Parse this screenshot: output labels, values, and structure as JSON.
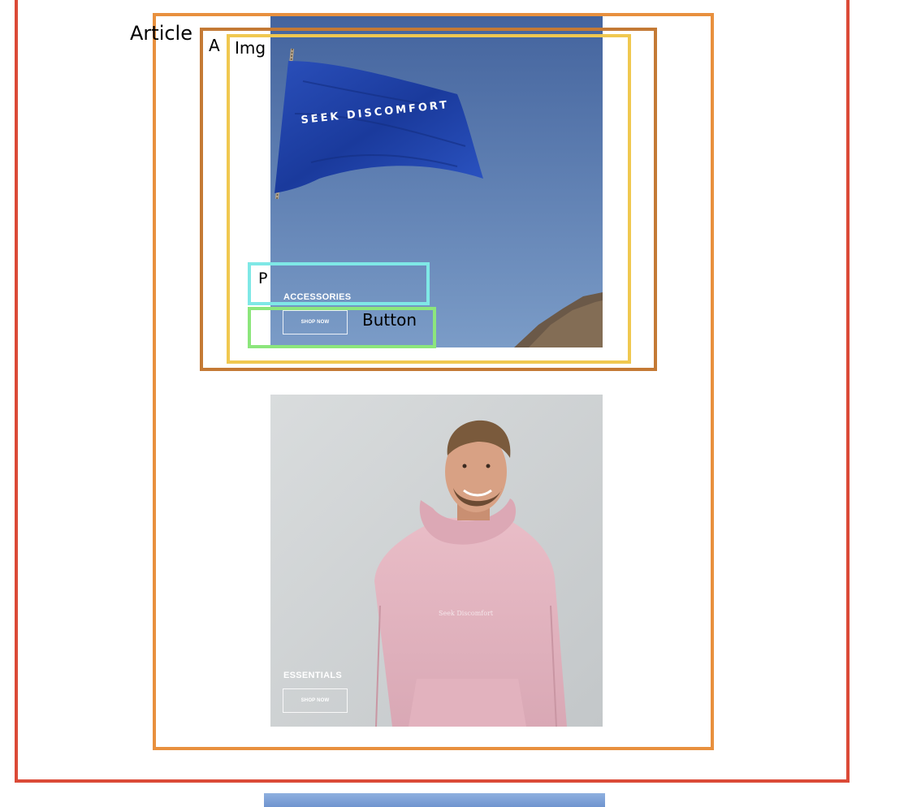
{
  "annotations": {
    "article": "Article",
    "a": "A",
    "img": "Img",
    "p": "P",
    "button": "Button"
  },
  "tiles": [
    {
      "category": "ACCESSORIES",
      "button": "SHOP NOW",
      "flag_text": "SEEK DISCOMFORT",
      "image": "flag-photo"
    },
    {
      "category": "ESSENTIALS",
      "button": "SHOP NOW",
      "shirt_text": "Seek Discomfort",
      "image": "hoodie-photo"
    }
  ],
  "colors": {
    "outer_box": "#db4a37",
    "article_box": "#e8903e",
    "a_box": "#c47a35",
    "img_box": "#f0c850",
    "p_box": "#7fe8e6",
    "button_box": "#8ce67c",
    "sky": "#5679ac",
    "flag": "#1f43a8",
    "hoodie": "#e6b6c2",
    "wall": "#d6dadb"
  }
}
